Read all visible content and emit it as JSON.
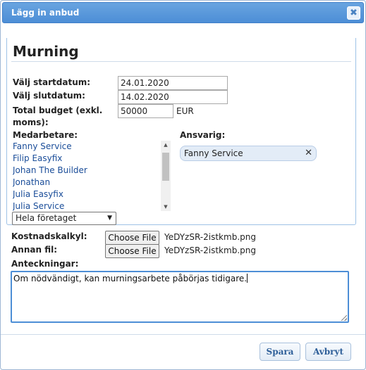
{
  "dialog": {
    "title": "Lägg in anbud",
    "close_glyph": "✖"
  },
  "section": {
    "title": "Murning"
  },
  "fields": {
    "start_label": "Välj startdatum:",
    "start_value": "24.01.2020",
    "end_label": "Välj slutdatum:",
    "end_value": "14.02.2020",
    "budget_label_line1": "Total budget (exkl.",
    "budget_label_line2": "moms):",
    "budget_value": "50000",
    "budget_unit": "EUR"
  },
  "staff": {
    "label": "Medarbetare:",
    "items": [
      "Fanny Service",
      "Filip Easyfix",
      "Johan The Builder",
      "Jonathan",
      "Julia Easyfix",
      "Julia Service"
    ],
    "group_select": "Hela företaget"
  },
  "responsible": {
    "label": "Ansvarig:",
    "selected": "Fanny Service",
    "remove_glyph": "✕"
  },
  "files": {
    "cost_label": "Kostnadskalkyl:",
    "cost_button": "Choose File",
    "cost_file": "YeDYzSR-2istkmb.png",
    "other_label": "Annan fil:",
    "other_button": "Choose File",
    "other_file": "YeDYzSR-2istkmb.png"
  },
  "notes": {
    "label": "Anteckningar:",
    "value": "Om nödvändigt, kan murningsarbete påbörjas tidigare."
  },
  "buttons": {
    "save": "Spara",
    "cancel": "Avbryt"
  }
}
